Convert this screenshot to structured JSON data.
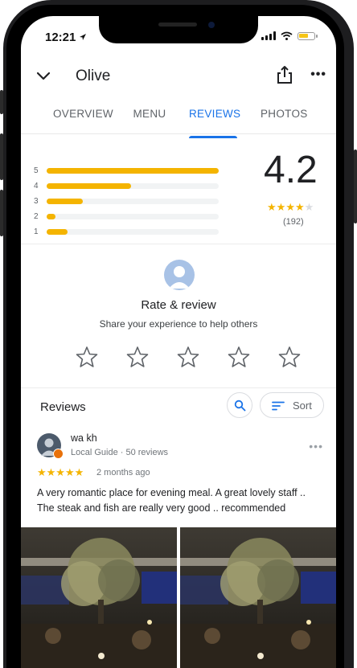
{
  "status": {
    "time": "12:21"
  },
  "header": {
    "title": "Olive"
  },
  "tabs": [
    {
      "label": "OVERVIEW",
      "active": false
    },
    {
      "label": "MENU",
      "active": false
    },
    {
      "label": "REVIEWS",
      "active": true
    },
    {
      "label": "PHOTOS",
      "active": false
    }
  ],
  "rating_summary": {
    "average": "4.2",
    "count": "(192)",
    "stars_filled": 4,
    "stars_total": 5,
    "distribution": [
      {
        "label": "5",
        "fraction": 1.0
      },
      {
        "label": "4",
        "fraction": 0.49
      },
      {
        "label": "3",
        "fraction": 0.21
      },
      {
        "label": "2",
        "fraction": 0.05
      },
      {
        "label": "1",
        "fraction": 0.12
      }
    ]
  },
  "rate_review": {
    "title": "Rate & review",
    "subtitle": "Share your experience to help others"
  },
  "reviews_section": {
    "heading": "Reviews",
    "sort_label": "Sort"
  },
  "review": {
    "author": "wa kh",
    "meta": "Local Guide · 50 reviews",
    "stars": "★★★★★",
    "time": "2 months ago",
    "text": "A very romantic place for evening meal. A great lovely staff .. The steak and fish are really very good .. recommended"
  },
  "colors": {
    "accent": "#1a73e8",
    "star": "#f4b400",
    "bar_track": "#f1f3f4"
  }
}
